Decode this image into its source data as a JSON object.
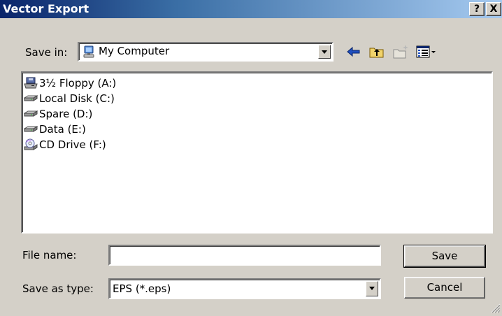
{
  "window": {
    "title": "Vector Export",
    "help_label": "?",
    "close_label": "X"
  },
  "save_in": {
    "label": "Save in:",
    "value": "My Computer",
    "icon": "computer-icon"
  },
  "toolbar": {
    "back_icon": "back-arrow-icon",
    "up_icon": "up-folder-icon",
    "new_folder_icon": "new-folder-icon",
    "views_icon": "view-menu-icon"
  },
  "files": [
    {
      "label": "3½ Floppy (A:)",
      "icon": "floppy-drive-icon"
    },
    {
      "label": "Local Disk (C:)",
      "icon": "hard-disk-icon"
    },
    {
      "label": "Spare (D:)",
      "icon": "hard-disk-icon"
    },
    {
      "label": "Data (E:)",
      "icon": "hard-disk-icon"
    },
    {
      "label": "CD Drive (F:)",
      "icon": "cd-drive-icon"
    }
  ],
  "file_name": {
    "label": "File name:",
    "value": "",
    "placeholder": ""
  },
  "save_as_type": {
    "label": "Save as type:",
    "value": "EPS (*.eps)"
  },
  "buttons": {
    "save": "Save",
    "cancel": "Cancel"
  },
  "colors": {
    "titlebar_start": "#0a246a",
    "titlebar_end": "#a6caf0",
    "face": "#d4d0c8"
  }
}
